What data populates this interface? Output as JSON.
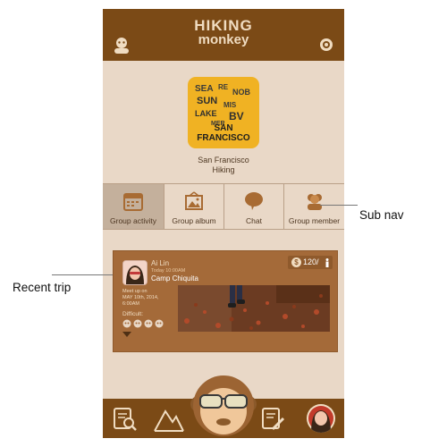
{
  "header": {
    "logo_line1": "HIKING",
    "logo_line2": "monkey"
  },
  "group": {
    "logo_caption": "SAN FRANCISCO",
    "name_line1": "San Francisco",
    "name_line2": "Hiking"
  },
  "subnav": {
    "tabs": [
      {
        "label": "Group activity",
        "icon": "calendar-icon",
        "active": true
      },
      {
        "label": "Group album",
        "icon": "photo-frame-icon",
        "active": false
      },
      {
        "label": "Chat",
        "icon": "chat-bubble-icon",
        "active": false
      },
      {
        "label": "Group member",
        "icon": "members-icon",
        "active": false
      }
    ]
  },
  "recent_trip": {
    "user_name": "Ai Lin",
    "posted_time": "Today 10:00AM",
    "trip_name": "Camp Chiquita",
    "price": "120/",
    "meet_up": "Meet up on\nMAY 10th, 2014,\n6:00AM",
    "difficulty_label": "Difficult:",
    "difficulty_icons": 4
  },
  "annotations": {
    "subnav": "Sub nav",
    "recent_trip": "Recent trip"
  },
  "colors": {
    "brand_brown": "#7b4a16",
    "background": "#e9d8c7",
    "card": "#a46a39",
    "logo_yellow": "#f0b223"
  },
  "bottom_nav": {
    "items": [
      "search-trips-icon",
      "mountains-icon",
      "monkey-home-icon",
      "write-post-icon",
      "profile-avatar-icon"
    ]
  }
}
